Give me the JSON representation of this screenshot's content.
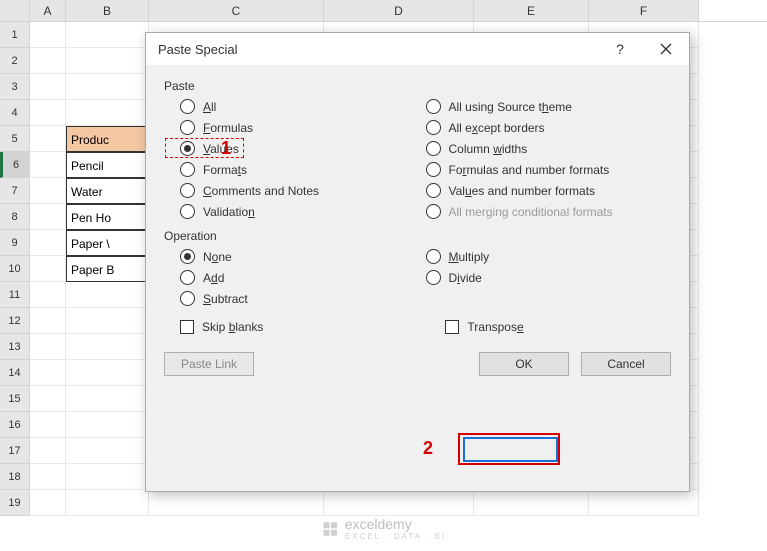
{
  "columns": [
    "A",
    "B",
    "C",
    "D",
    "E",
    "F"
  ],
  "rowNumbers": [
    "1",
    "2",
    "3",
    "4",
    "5",
    "6",
    "7",
    "8",
    "9",
    "10",
    "11",
    "12",
    "13",
    "14",
    "15",
    "16",
    "17",
    "18",
    "19"
  ],
  "selectedRow": "6",
  "cells": {
    "b5": "Produc",
    "b6": "Pencil",
    "b7": "Water",
    "b8": "Pen Ho",
    "b9": "Paper \\",
    "b10": "Paper B"
  },
  "dialog": {
    "title": "Paste Special",
    "help": "?",
    "group_paste": "Paste",
    "group_operation": "Operation",
    "left_paste": [
      {
        "label_pre": "",
        "u": "A",
        "label_post": "ll",
        "checked": false,
        "name": "all"
      },
      {
        "label_pre": "",
        "u": "F",
        "label_post": "ormulas",
        "checked": false,
        "name": "formulas"
      },
      {
        "label_pre": "",
        "u": "V",
        "label_post": "alues",
        "checked": true,
        "name": "values"
      },
      {
        "label_pre": "Forma",
        "u": "t",
        "label_post": "s",
        "checked": false,
        "name": "formats"
      },
      {
        "label_pre": "",
        "u": "C",
        "label_post": "omments and Notes",
        "checked": false,
        "name": "comments"
      },
      {
        "label_pre": "Validatio",
        "u": "n",
        "label_post": "",
        "checked": false,
        "name": "validation"
      }
    ],
    "right_paste": [
      {
        "label_pre": "All using Source t",
        "u": "h",
        "label_post": "eme",
        "checked": false,
        "name": "all-source-theme"
      },
      {
        "label_pre": "All e",
        "u": "x",
        "label_post": "cept borders",
        "checked": false,
        "name": "all-except-borders"
      },
      {
        "label_pre": "Column ",
        "u": "w",
        "label_post": "idths",
        "checked": false,
        "name": "column-widths"
      },
      {
        "label_pre": "Fo",
        "u": "r",
        "label_post": "mulas and number formats",
        "checked": false,
        "name": "formulas-number-formats"
      },
      {
        "label_pre": "Val",
        "u": "u",
        "label_post": "es and number formats",
        "checked": false,
        "name": "values-number-formats"
      },
      {
        "label_pre": "All mer",
        "u": "g",
        "label_post": "ing conditional formats",
        "checked": false,
        "name": "all-merging-conditional",
        "disabled": true
      }
    ],
    "left_op": [
      {
        "label_pre": "N",
        "u": "o",
        "label_post": "ne",
        "checked": true,
        "name": "none"
      },
      {
        "label_pre": "A",
        "u": "d",
        "label_post": "d",
        "checked": false,
        "name": "add"
      },
      {
        "label_pre": "",
        "u": "S",
        "label_post": "ubtract",
        "checked": false,
        "name": "subtract"
      }
    ],
    "right_op": [
      {
        "label_pre": "",
        "u": "M",
        "label_post": "ultiply",
        "checked": false,
        "name": "multiply"
      },
      {
        "label_pre": "D",
        "u": "i",
        "label_post": "vide",
        "checked": false,
        "name": "divide"
      }
    ],
    "skip_blanks": {
      "label_pre": "Skip ",
      "u": "b",
      "label_post": "lanks"
    },
    "transpose": {
      "label_pre": "Transpos",
      "u": "e",
      "label_post": ""
    },
    "paste_link": "Paste Link",
    "ok": "OK",
    "cancel": "Cancel"
  },
  "annotations": {
    "one": "1",
    "two": "2"
  },
  "watermark": {
    "name": "exceldemy",
    "sub": "EXCEL · DATA · BI"
  }
}
